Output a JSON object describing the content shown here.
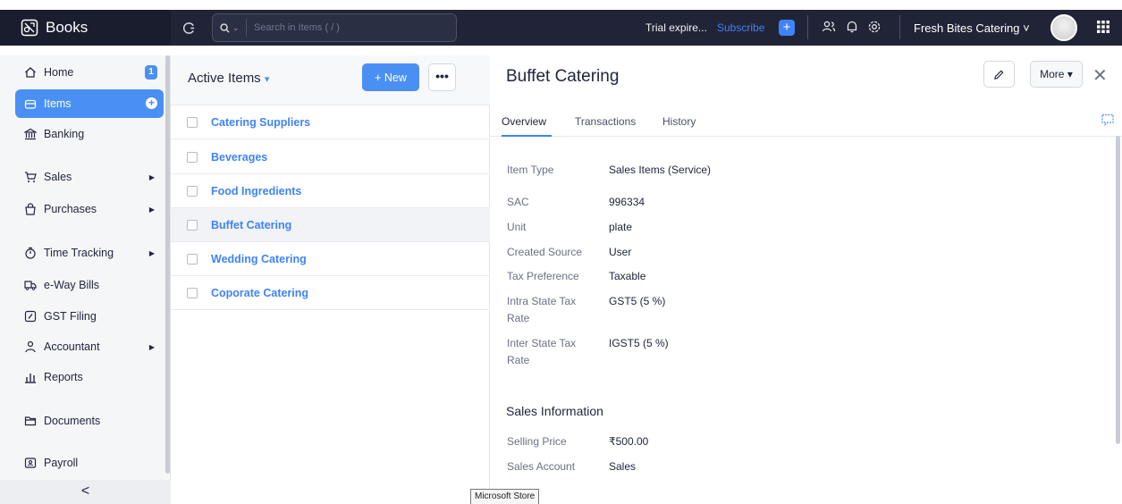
{
  "app": {
    "brand": "Books",
    "search_placeholder": "Search in Items ( / )",
    "trial_text": "Trial expire...",
    "subscribe_label": "Subscribe",
    "org_name": "Fresh Bites Catering ˅"
  },
  "sidebar": {
    "items": [
      {
        "label": "Home",
        "badge": "1"
      },
      {
        "label": "Items"
      },
      {
        "label": "Banking"
      },
      {
        "label": "Sales"
      },
      {
        "label": "Purchases"
      },
      {
        "label": "Time Tracking"
      },
      {
        "label": "e-Way Bills"
      },
      {
        "label": "GST Filing"
      },
      {
        "label": "Accountant"
      },
      {
        "label": "Reports"
      },
      {
        "label": "Documents"
      },
      {
        "label": "Payroll"
      }
    ],
    "collapse_label": "<"
  },
  "list": {
    "title": "Active Items",
    "new_label": "+ New",
    "more_label": "•••",
    "items": [
      "Catering Suppliers",
      "Beverages",
      "Food Ingredients",
      "Buffet Catering",
      "Wedding Catering",
      "Coporate Catering"
    ]
  },
  "detail": {
    "title": "Buffet Catering",
    "more_label": "More ▾",
    "tabs": [
      "Overview",
      "Transactions",
      "History"
    ],
    "fields": [
      {
        "label": "Item Type",
        "value": "Sales Items (Service)"
      },
      {
        "label": "SAC",
        "value": "996334"
      },
      {
        "label": "Unit",
        "value": "plate"
      },
      {
        "label": "Created Source",
        "value": "User"
      },
      {
        "label": "Tax Preference",
        "value": "Taxable"
      },
      {
        "label": "Intra State Tax Rate",
        "value": "GST5 (5 %)"
      },
      {
        "label": "Inter State Tax Rate",
        "value": "IGST5 (5 %)"
      }
    ],
    "sales_section_title": "Sales Information",
    "sales_fields": [
      {
        "label": "Selling Price",
        "value": "₹500.00"
      },
      {
        "label": "Sales Account",
        "value": "Sales"
      }
    ]
  },
  "tooltip": "Microsoft Store",
  "colors": {
    "accent": "#4a90f4",
    "topbar": "#202436",
    "link": "#3f83f8"
  }
}
